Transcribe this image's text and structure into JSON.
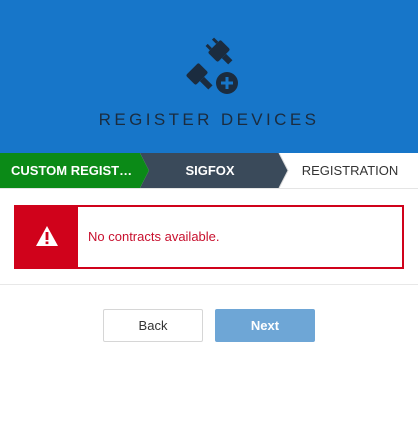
{
  "header": {
    "icon": "plug-plus-icon",
    "title": "REGISTER DEVICES"
  },
  "steps": [
    {
      "label": "CUSTOM REGIST…",
      "state": "completed",
      "color": "#0b8a17"
    },
    {
      "label": "SIGFOX",
      "state": "current",
      "color": "#3a4a5a"
    },
    {
      "label": "REGISTRATION",
      "state": "upcoming",
      "color": "#ffffff"
    }
  ],
  "alert": {
    "icon": "warning-icon",
    "message": "No contracts available.",
    "color": "#d0021b"
  },
  "buttons": {
    "back_label": "Back",
    "next_label": "Next"
  },
  "colors": {
    "header_bg": "#1776c9",
    "primary_button": "#6ea6d6"
  }
}
